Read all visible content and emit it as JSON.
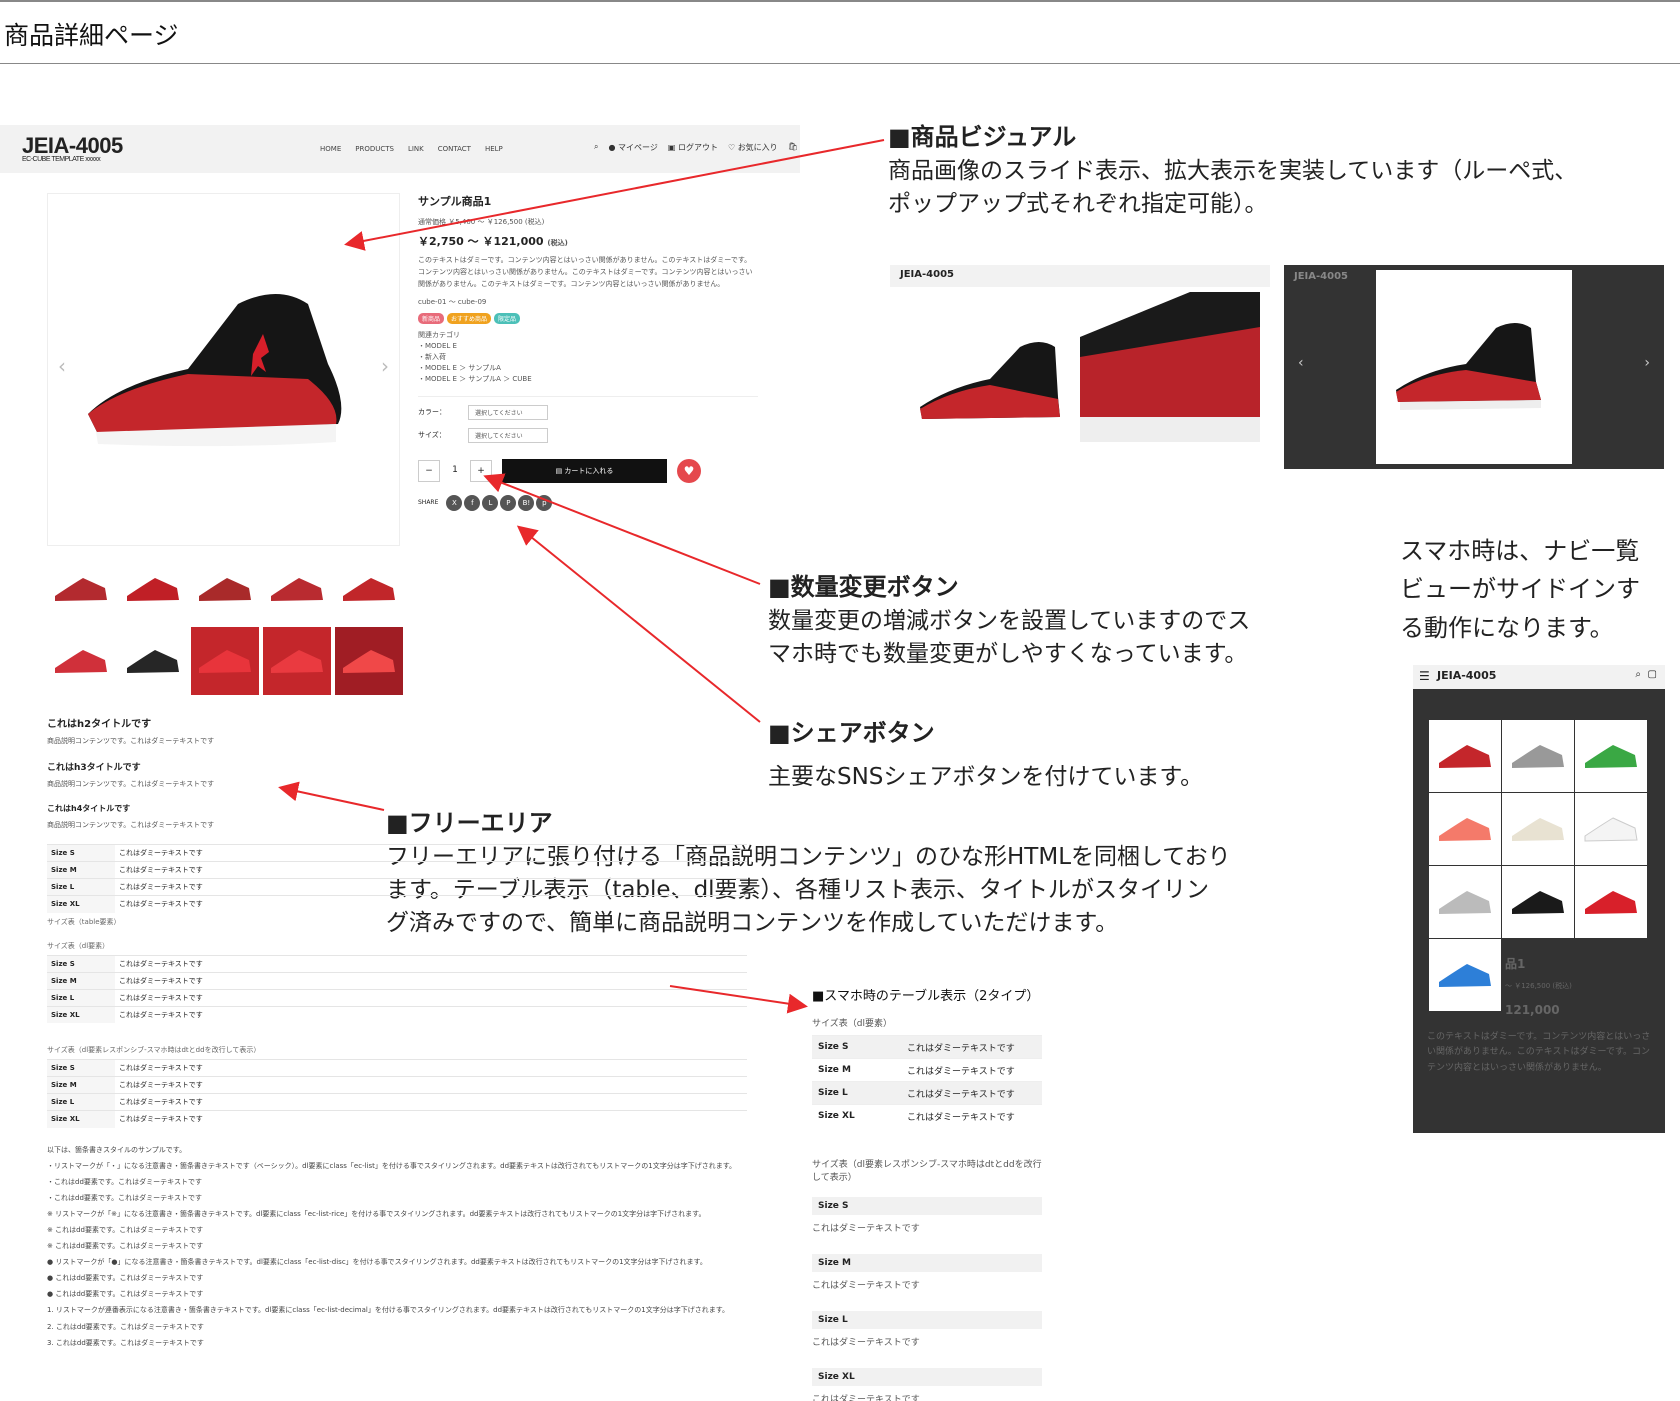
{
  "page_title": "商品詳細ページ",
  "callouts": {
    "visual": {
      "title": "■商品ビジュアル",
      "lines": [
        "商品画像のスライド表示、拡大表示を実装しています（ルーペ式、",
        "ポップアップ式それぞれ指定可能）。"
      ]
    },
    "qty": {
      "title": "■数量変更ボタン",
      "lines": [
        "数量変更の増減ボタンを設置していますのでス",
        "マホ時でも数量変更がしやすくなっています。"
      ]
    },
    "share": {
      "title": "■シェアボタン",
      "lines": [
        "主要なSNSシェアボタンを付けています。"
      ]
    },
    "free": {
      "title": "■フリーエリア",
      "lines": [
        "フリーエリアに張り付ける「商品説明コンテンツ」のひな形HTMLを同梱しており",
        "ます。テーブル表示（table、dl要素）、各種リスト表示、タイトルがスタイリン",
        "グ済みですので、簡単に商品説明コンテンツを作成していただけます。"
      ]
    },
    "sp_nav": {
      "lines": [
        "スマホ時は、ナビ一覧",
        "ビューがサイドインす",
        "る動作になります。"
      ]
    }
  },
  "site": {
    "logo": "JEIA-4005",
    "logo_sub": "EC-CUBE TEMPLATE xxxxx",
    "gnav": [
      "HOME",
      "PRODUCTS",
      "LINK",
      "CONTACT",
      "HELP"
    ],
    "unav": [
      "マイページ",
      "ログアウト",
      "お気に入り"
    ],
    "product": {
      "name": "サンプル商品1",
      "regular": "通常価格 ￥5,400 〜 ￥126,500 (税込)",
      "price": "￥2,750 〜 ￥121,000",
      "tax": "(税込)",
      "desc": "このテキストはダミーです。コンテンツ内容とはいっさい関係がありません。このテキストはダミーです。コンテンツ内容とはいっさい関係がありません。このテキストはダミーです。コンテンツ内容とはいっさい関係がありません。このテキストはダミーです。コンテンツ内容とはいっさい関係がありません。",
      "code": "cube-01 〜 cube-09",
      "tags": [
        "新商品",
        "おすすめ商品",
        "限定品"
      ],
      "tag_colors": [
        "#e86b7a",
        "#f0a21f",
        "#4cc0b8"
      ],
      "cat_label": "関連カテゴリ",
      "cats": [
        "・MODEL E",
        "・新入荷",
        "・MODEL E ＞ サンプルA",
        "・MODEL E ＞ サンプルA ＞ CUBE"
      ],
      "color_label": "カラー：",
      "size_label": "サイズ：",
      "select_ph": "選択してください",
      "qty": "1",
      "minus": "−",
      "plus": "+",
      "cart": "カートに入れる",
      "share_label": "SHARE",
      "share_icons": [
        "X",
        "f",
        "L",
        "P",
        "B!",
        "p"
      ]
    },
    "free": {
      "h2": "これはh2タイトルです",
      "h3": "これはh3タイトルです",
      "h4": "これはh4タイトルです",
      "p": "商品説明コンテンツです。これはダミーテキストです",
      "rows": [
        [
          "Size S",
          "これはダミーテキストです"
        ],
        [
          "Size M",
          "これはダミーテキストです"
        ],
        [
          "Size L",
          "これはダミーテキストです"
        ],
        [
          "Size XL",
          "これはダミーテキストです"
        ]
      ],
      "cap1": "サイズ表（table要素）",
      "cap2": "サイズ表（dl要素）",
      "cap3": "サイズ表（dl要素レスポンシブ-スマホ時はdtとddを改行して表示）",
      "list_intro": "以下は、箇条書きスタイルのサンプルです。",
      "list": [
        "・リストマークが「・」になる注意書き・箇条書きテキストです（ベーシック）。dl要素にclass「ec-list」を付ける事でスタイリングされます。dd要素テキストは改行されてもリストマークの1文字分は字下げされます。",
        "・これはdd要素です。これはダミーテキストです",
        "・これはdd要素です。これはダミーテキストです",
        "※ リストマークが「※」になる注意書き・箇条書きテキストです。dl要素にclass「ec-list-rice」を付ける事でスタイリングされます。dd要素テキストは改行されてもリストマークの1文字分は字下げされます。",
        "※ これはdd要素です。これはダミーテキストです",
        "※ これはdd要素です。これはダミーテキストです",
        "● リストマークが「●」になる注意書き・箇条書きテキストです。dl要素にclass「ec-list-disc」を付ける事でスタイリングされます。dd要素テキストは改行されてもリストマークの1文字分は字下げされます。",
        "● これはdd要素です。これはダミーテキストです",
        "● これはdd要素です。これはダミーテキストです",
        "1. リストマークが連番表示になる注意書き・箇条書きテキストです。dl要素にclass「ec-list-decimal」を付ける事でスタイリングされます。dd要素テキストは改行されてもリストマークの1文字分は字下げされます。",
        "2. これはdd要素です。これはダミーテキストです",
        "3. これはdd要素です。これはダミーテキストです"
      ]
    }
  },
  "sp_table": {
    "heading": "■スマホ時のテーブル表示（2タイプ）",
    "cap1": "サイズ表（dl要素）",
    "cap2": "サイズ表（dl要素レスポンシブ-スマホ時はdtとddを改行して表示）",
    "rows": [
      [
        "Size S",
        "これはダミーテキストです"
      ],
      [
        "Size M",
        "これはダミーテキストです"
      ],
      [
        "Size L",
        "これはダミーテキストです"
      ],
      [
        "Size XL",
        "これはダミーテキストです"
      ]
    ]
  },
  "phone": {
    "logo": "JEIA-4005",
    "name_fragment": "品1",
    "price_fragment": "121,000",
    "regular_fragment": "〜 ￥126,500 (税込)",
    "desc": "このテキストはダミーです。コンテンツ内容とはいっさい関係がありません。このテキストはダミーです。コンテンツ内容とはいっさい関係がありません。"
  },
  "colors": {
    "accent_red": "#e8282b",
    "dark": "#111111"
  }
}
